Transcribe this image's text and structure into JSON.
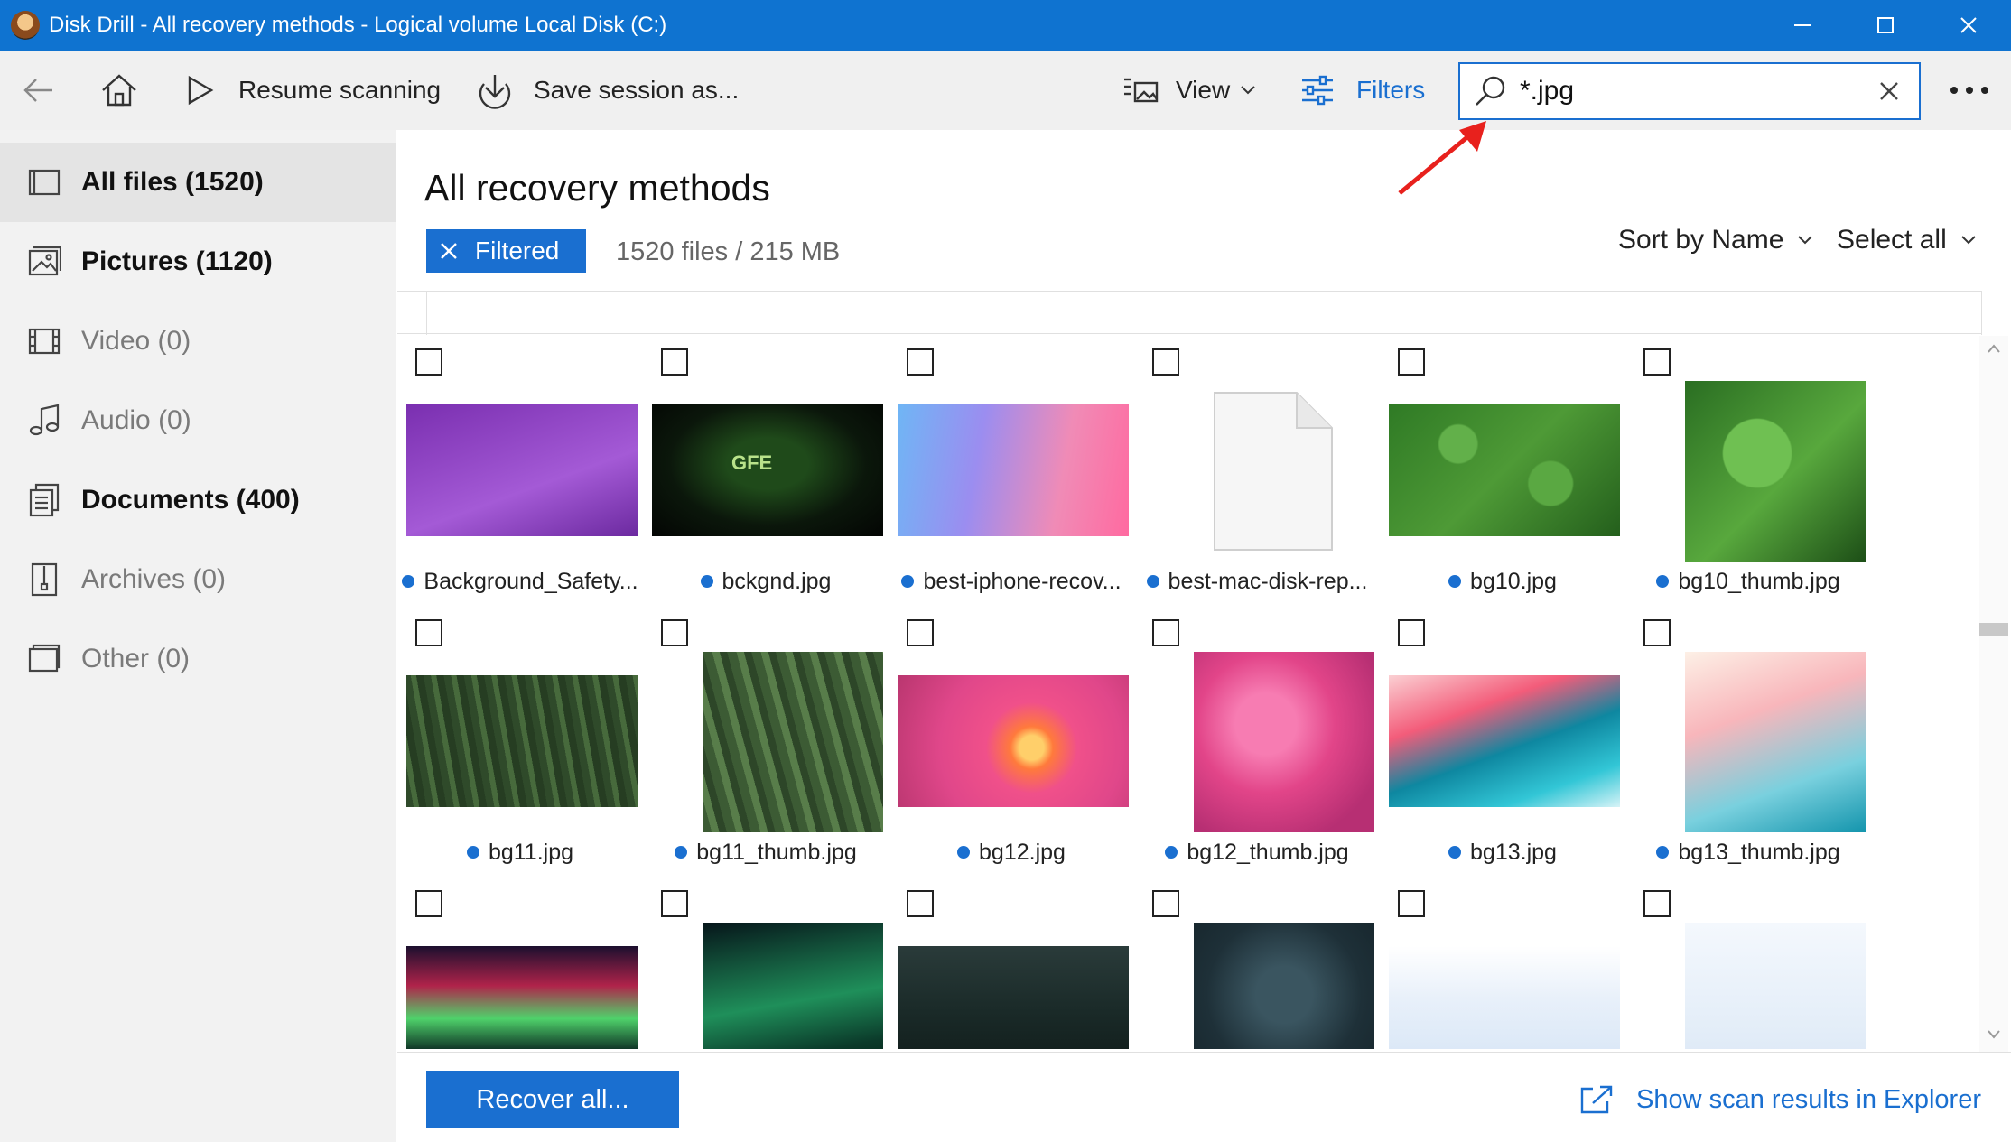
{
  "window": {
    "title": "Disk Drill - All recovery methods - Logical volume Local Disk (C:)"
  },
  "toolbar": {
    "resume_label": "Resume scanning",
    "save_label": "Save session as...",
    "view_label": "View",
    "filters_label": "Filters",
    "search_value": "*.jpg"
  },
  "sidebar": {
    "items": [
      {
        "label": "All files (1520)",
        "icon": "all-files-icon"
      },
      {
        "label": "Pictures (1120)",
        "icon": "pictures-icon"
      },
      {
        "label": "Video (0)",
        "icon": "video-icon"
      },
      {
        "label": "Audio (0)",
        "icon": "audio-icon"
      },
      {
        "label": "Documents (400)",
        "icon": "documents-icon"
      },
      {
        "label": "Archives (0)",
        "icon": "archives-icon"
      },
      {
        "label": "Other (0)",
        "icon": "other-icon"
      }
    ]
  },
  "main": {
    "title": "All recovery methods",
    "filter_chip": "Filtered",
    "summary": "1520 files / 215 MB",
    "sort_label": "Sort by Name",
    "select_label": "Select all"
  },
  "files": [
    {
      "name": "Background_Safety...",
      "kind": "workspace"
    },
    {
      "name": "bckgnd.jpg",
      "kind": "gfe"
    },
    {
      "name": "best-iphone-recov...",
      "kind": "phones"
    },
    {
      "name": "best-mac-disk-rep...",
      "kind": "blank"
    },
    {
      "name": "bg10.jpg",
      "kind": "clover"
    },
    {
      "name": "bg10_thumb.jpg",
      "kind": "clover-thumb"
    },
    {
      "name": "bg11.jpg",
      "kind": "forest"
    },
    {
      "name": "bg11_thumb.jpg",
      "kind": "forest-thumb"
    },
    {
      "name": "bg12.jpg",
      "kind": "flower"
    },
    {
      "name": "bg12_thumb.jpg",
      "kind": "flower-thumb"
    },
    {
      "name": "bg13.jpg",
      "kind": "wave"
    },
    {
      "name": "bg13_thumb.jpg",
      "kind": "wave-thumb"
    },
    {
      "name": "",
      "kind": "aurora"
    },
    {
      "name": "",
      "kind": "aurora-thumb"
    },
    {
      "name": "",
      "kind": "dark-forest"
    },
    {
      "name": "",
      "kind": "dark-forest-thumb"
    },
    {
      "name": "",
      "kind": "snow"
    },
    {
      "name": "",
      "kind": "snowman"
    }
  ],
  "footer": {
    "recover_label": "Recover all...",
    "explorer_label": "Show scan results in Explorer"
  },
  "colors": {
    "accent": "#1a6fd0",
    "titlebar": "#0f73d0",
    "annotation_arrow": "#e8211d"
  }
}
